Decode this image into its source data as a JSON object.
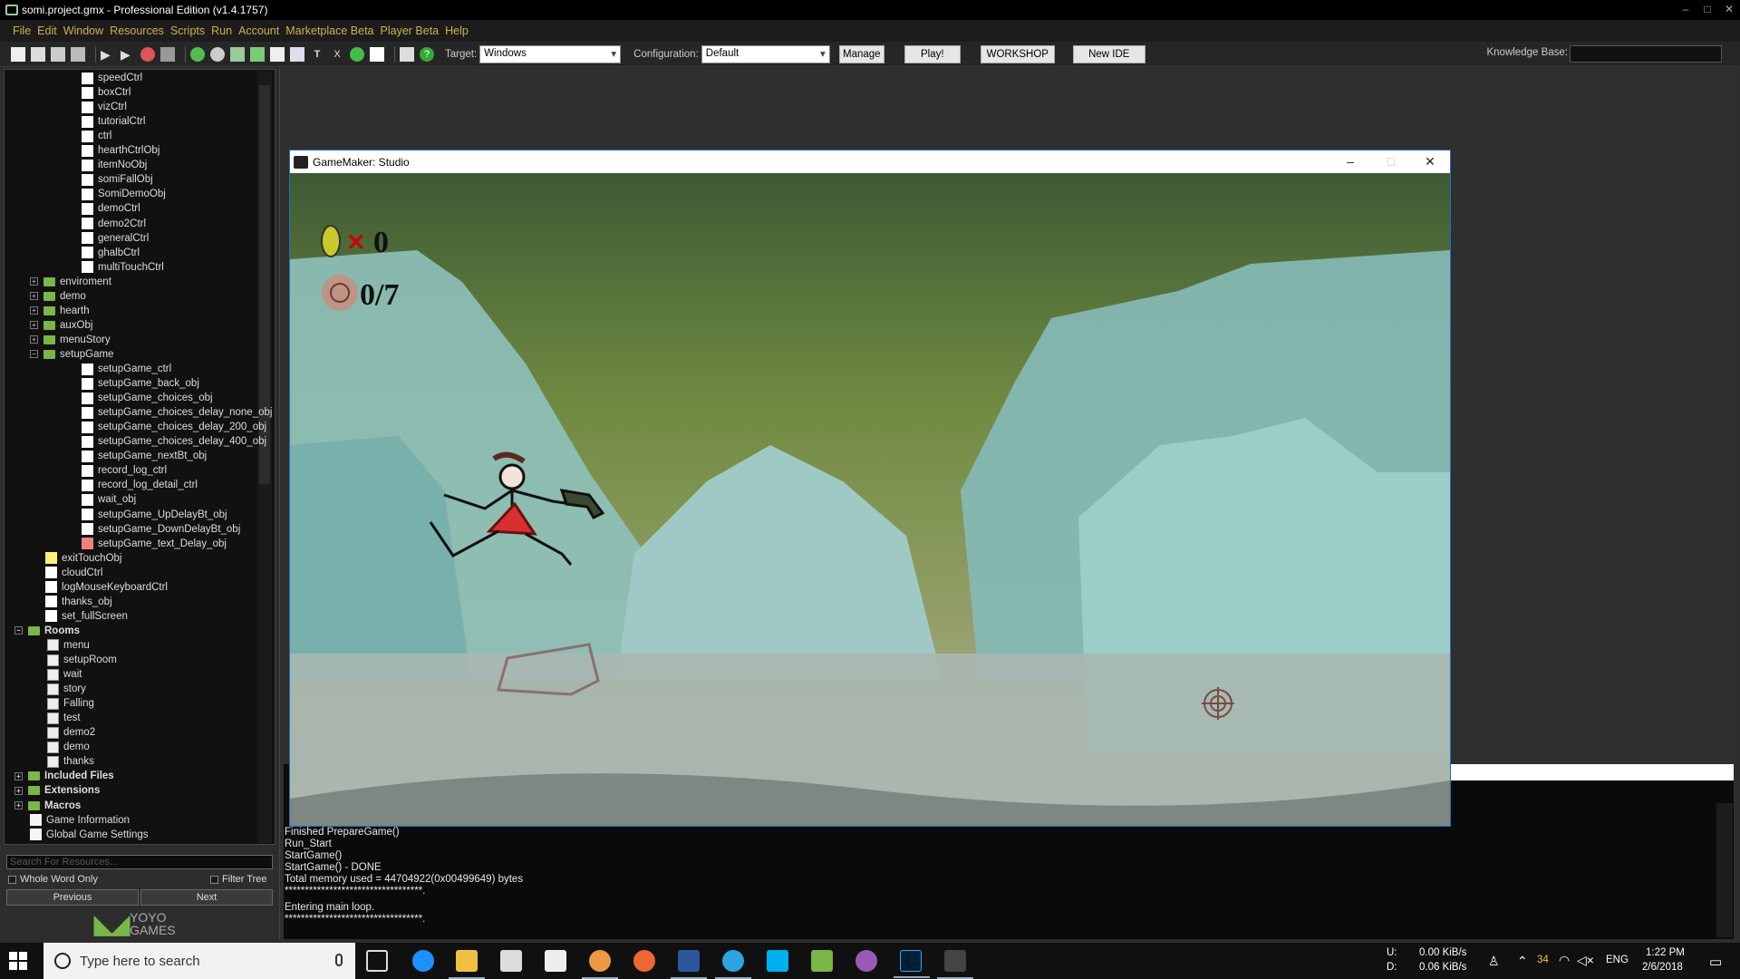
{
  "window": {
    "title": "somi.project.gmx - Professional Edition (v1.4.1757)",
    "controls": [
      "–",
      "□",
      "✕"
    ]
  },
  "menu": [
    "File",
    "Edit",
    "Window",
    "Resources",
    "Scripts",
    "Run",
    "Account",
    "Marketplace Beta",
    "Player Beta",
    "Help"
  ],
  "toolbar": {
    "target_label": "Target:",
    "target_value": "Windows",
    "config_label": "Configuration:",
    "config_value": "Default",
    "manage": "Manage",
    "play": "Play!",
    "workshop": "WORKSHOP",
    "new_ide": "New IDE",
    "kb_label": "Knowledge Base:"
  },
  "tree": {
    "items": [
      {
        "label": "speedCtrl",
        "icon": "blank"
      },
      {
        "label": "boxCtrl",
        "icon": "blank"
      },
      {
        "label": "vizCtrl",
        "icon": "blank"
      },
      {
        "label": "tutorialCtrl",
        "icon": "blank"
      },
      {
        "label": "ctrl",
        "icon": "blank"
      },
      {
        "label": "hearthCtrlObj",
        "icon": "blank"
      },
      {
        "label": "itemNoObj",
        "icon": "blank"
      },
      {
        "label": "somiFallObj",
        "icon": "blank"
      },
      {
        "label": "SomiDemoObj",
        "icon": "blank"
      },
      {
        "label": "demoCtrl",
        "icon": "blank"
      },
      {
        "label": "demo2Ctrl",
        "icon": "blank"
      },
      {
        "label": "generalCtrl",
        "icon": "blank"
      },
      {
        "label": "ghalbCtrl",
        "icon": "blank"
      },
      {
        "label": "multiTouchCtrl",
        "icon": "blank"
      },
      {
        "label": "enviroment",
        "icon": "folder"
      },
      {
        "label": "demo",
        "icon": "folder"
      },
      {
        "label": "hearth",
        "icon": "folder"
      },
      {
        "label": "auxObj",
        "icon": "folder"
      },
      {
        "label": "menuStory",
        "icon": "folder"
      },
      {
        "label": "setupGame",
        "icon": "folder"
      },
      {
        "label": "setupGame_ctrl",
        "icon": "blank"
      },
      {
        "label": "setupGame_back_obj",
        "icon": "sprite"
      },
      {
        "label": "setupGame_choices_obj",
        "icon": "sprite"
      },
      {
        "label": "setupGame_choices_delay_none_obj",
        "icon": "sprite"
      },
      {
        "label": "setupGame_choices_delay_200_obj",
        "icon": "sprite"
      },
      {
        "label": "setupGame_choices_delay_400_obj",
        "icon": "sprite"
      },
      {
        "label": "setupGame_nextBt_obj",
        "icon": "sprite"
      },
      {
        "label": "record_log_ctrl",
        "icon": "blank"
      },
      {
        "label": "record_log_detail_ctrl",
        "icon": "blank"
      },
      {
        "label": "wait_obj",
        "icon": "blank"
      },
      {
        "label": "setupGame_UpDelayBt_obj",
        "icon": "arrow"
      },
      {
        "label": "setupGame_DownDelayBt_obj",
        "icon": "arrow"
      },
      {
        "label": "setupGame_text_Delay_obj",
        "icon": "red"
      },
      {
        "label": "exitTouchObj",
        "icon": "yellow"
      },
      {
        "label": "cloudCtrl",
        "icon": "blank"
      },
      {
        "label": "logMouseKeyboardCtrl",
        "icon": "blank"
      },
      {
        "label": "thanks_obj",
        "icon": "blank"
      },
      {
        "label": "set_fullScreen",
        "icon": "blank"
      },
      {
        "label": "Rooms",
        "icon": "folder"
      },
      {
        "label": "menu",
        "icon": "room"
      },
      {
        "label": "setupRoom",
        "icon": "room"
      },
      {
        "label": "wait",
        "icon": "room"
      },
      {
        "label": "story",
        "icon": "room"
      },
      {
        "label": "Falling",
        "icon": "room"
      },
      {
        "label": "test",
        "icon": "room"
      },
      {
        "label": "demo2",
        "icon": "room"
      },
      {
        "label": "demo",
        "icon": "room"
      },
      {
        "label": "thanks",
        "icon": "room"
      },
      {
        "label": "Included Files",
        "icon": "folder"
      },
      {
        "label": "Extensions",
        "icon": "folder"
      },
      {
        "label": "Macros",
        "icon": "folder"
      },
      {
        "label": "Game Information",
        "icon": "doc"
      },
      {
        "label": "Global Game Settings",
        "icon": "doc"
      }
    ],
    "search_placeholder": "Search For Resources...",
    "whole_word": "Whole Word Only",
    "filter_tree": "Filter Tree",
    "previous": "Previous",
    "next": "Next",
    "brand": [
      "YOYO",
      "GAMES"
    ]
  },
  "game_window": {
    "title": "GameMaker: Studio",
    "hud_coins": "0",
    "hud_targets": "0/7"
  },
  "output": [
    "Finished PrepareGame()",
    "Run_Start",
    "StartGame()",
    "StartGame() - DONE",
    "Total memory used = 44704922(0x00499649) bytes",
    "**********************************.",
    "Entering main loop.",
    "**********************************."
  ],
  "taskbar": {
    "search_placeholder": "Type here to search",
    "net_up_label": "U:",
    "net_down_label": "D:",
    "net_up": "0.00 KiB/s",
    "net_down": "0.06 KiB/s",
    "tray_badge": "34",
    "lang": "ENG",
    "time": "1:22 PM",
    "date": "2/6/2018"
  },
  "colors": {
    "menu_text": "#d0b050",
    "window_border": "#1b6fc7",
    "folder": "#7ab648"
  }
}
